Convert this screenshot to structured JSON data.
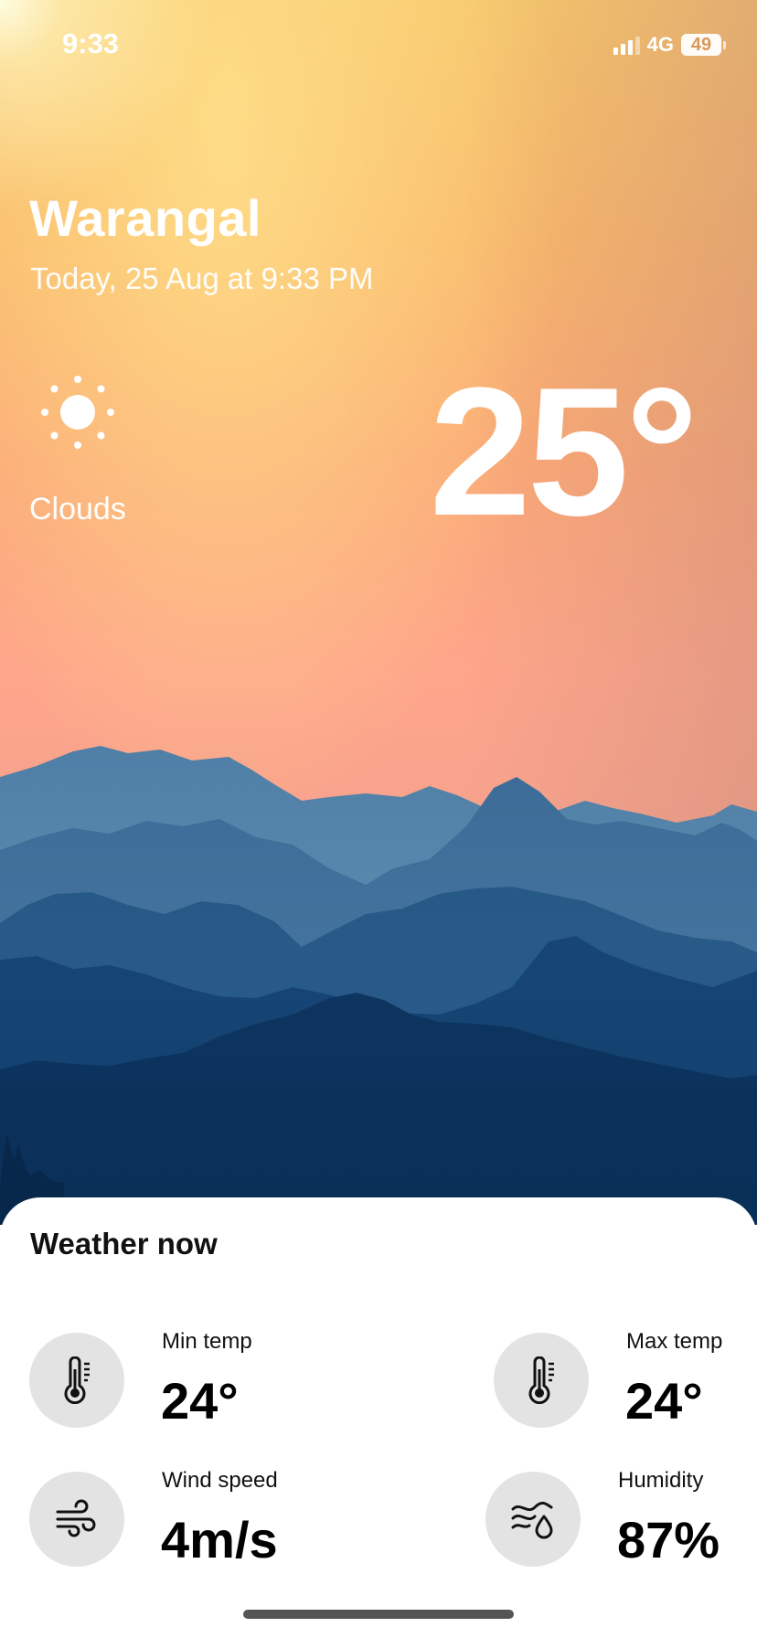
{
  "status_bar": {
    "time": "9:33",
    "network": "4G",
    "battery": "49"
  },
  "location": {
    "city": "Warangal",
    "datetime": "Today, 25 Aug at 9:33 PM"
  },
  "current": {
    "condition": "Clouds",
    "condition_icon": "sun-icon",
    "temperature": "25°"
  },
  "details": {
    "title": "Weather now",
    "items": [
      {
        "label": "Min temp",
        "value": "24°",
        "icon": "thermometer-icon"
      },
      {
        "label": "Max temp",
        "value": "24°",
        "icon": "thermometer-icon"
      },
      {
        "label": "Wind speed",
        "value": "4m/s",
        "icon": "wind-icon"
      },
      {
        "label": "Humidity",
        "value": "87%",
        "icon": "humidity-icon"
      }
    ]
  },
  "colors": {
    "sky_top": "#f6c76a",
    "sky_bottom": "#fea58b",
    "mountain_dark": "#0d3560",
    "card_bg": "#ffffff",
    "icon_circle": "#e3e3e3"
  }
}
